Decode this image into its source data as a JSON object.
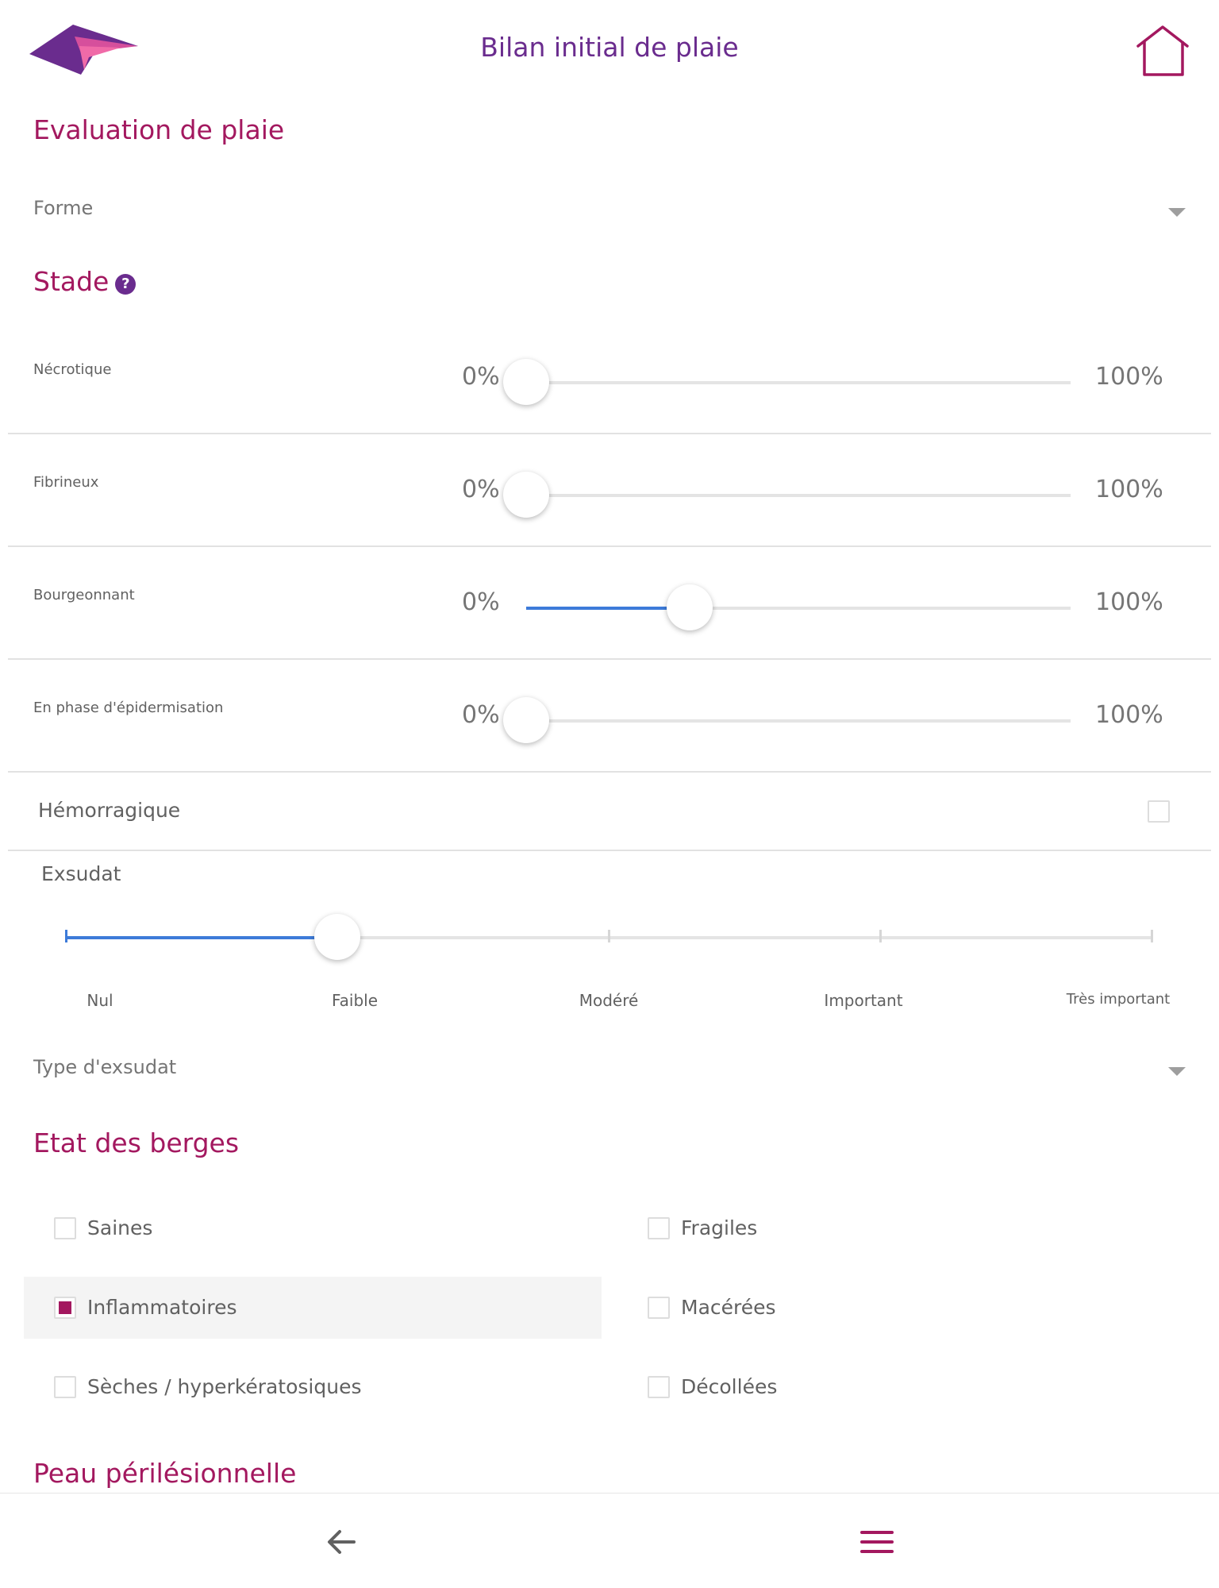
{
  "header": {
    "title": "Bilan initial de plaie",
    "logo_icon": "brand-logo",
    "home_icon": "home-icon"
  },
  "evaluation": {
    "title": "Evaluation de plaie",
    "forme_select": {
      "label": "Forme",
      "icon": "chevron-down-icon"
    }
  },
  "stade": {
    "title": "Stade",
    "help_icon": "?",
    "min_label": "0%",
    "max_label": "100%",
    "rows": [
      {
        "label": "Nécrotique",
        "value_percent": 0
      },
      {
        "label": "Fibrineux",
        "value_percent": 0
      },
      {
        "label": "Bourgeonnant",
        "value_percent": 30
      },
      {
        "label": "En phase d'épidermisation",
        "value_percent": 0
      }
    ]
  },
  "hemorragique": {
    "label": "Hémorragique",
    "checked": false
  },
  "exsudat": {
    "label": "Exsudat",
    "levels": [
      "Nul",
      "Faible",
      "Modéré",
      "Important",
      "Très important"
    ],
    "selected_index": 1
  },
  "type_exsudat_select": {
    "label": "Type d'exsudat",
    "icon": "chevron-down-icon"
  },
  "berges": {
    "title": "Etat des berges",
    "options": [
      {
        "label": "Saines",
        "checked": false
      },
      {
        "label": "Fragiles",
        "checked": false
      },
      {
        "label": "Inflammatoires",
        "checked": true
      },
      {
        "label": "Macérées",
        "checked": false
      },
      {
        "label": "Sèches / hyperkératosiques",
        "checked": false
      },
      {
        "label": "Décollées",
        "checked": false
      }
    ]
  },
  "peau": {
    "title": "Peau périlésionnelle"
  },
  "nav": {
    "back_icon": "arrow-left-icon",
    "menu_icon": "menu-icon"
  },
  "colors": {
    "brand_purple": "#6a2c8e",
    "section_magenta": "#a3185f",
    "slider_blue": "#3d7bd9",
    "checkbox_checked": "#a3185f"
  }
}
